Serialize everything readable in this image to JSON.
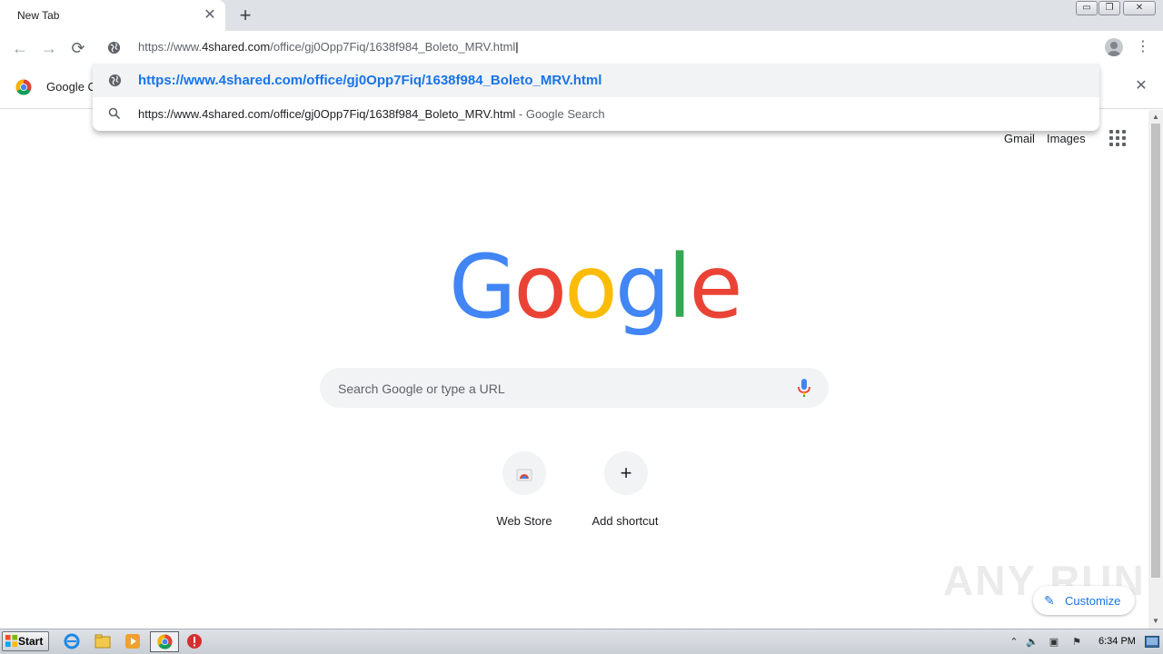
{
  "browser": {
    "tab": {
      "title": "New Tab",
      "close": "✕"
    },
    "new_tab": "+",
    "window_controls": {
      "minimize": "▭",
      "restore": "❐",
      "close": "✕"
    },
    "nav": {
      "back": "←",
      "forward": "→",
      "reload": "⟳"
    },
    "omnibox": {
      "text_prefix": "https://www.",
      "text_domain": "4shared.com",
      "text_path": "/office/gj0Opp7Fiq/1638f984_Boleto_MRV.html"
    },
    "menu": "⋮"
  },
  "infobar": {
    "text": "Google Cl",
    "close": "✕"
  },
  "dropdown": {
    "suggestions": [
      {
        "icon": "globe-icon",
        "text": "https://www.4shared.com/office/gj0Opp7Fiq/1638f984_Boleto_MRV.html"
      },
      {
        "icon": "search-icon",
        "text": "https://www.4shared.com/office/gj0Opp7Fiq/1638f984_Boleto_MRV.html",
        "suffix": " - Google Search"
      }
    ]
  },
  "ntp": {
    "links": {
      "gmail": "Gmail",
      "images": "Images"
    },
    "logo_letters": [
      {
        "char": "G",
        "color": "#4285F4"
      },
      {
        "char": "o",
        "color": "#EA4335"
      },
      {
        "char": "o",
        "color": "#FBBC05"
      },
      {
        "char": "g",
        "color": "#4285F4"
      },
      {
        "char": "l",
        "color": "#34A853"
      },
      {
        "char": "e",
        "color": "#EA4335"
      }
    ],
    "search_placeholder": "Search Google or type a URL",
    "shortcuts": [
      {
        "label": "Web Store",
        "icon": "web-store-icon"
      },
      {
        "label": "Add shortcut",
        "icon": "plus-icon",
        "glyph": "+"
      }
    ],
    "customize": {
      "label": "Customize",
      "icon": "✎"
    }
  },
  "watermark": "ANY RUN",
  "scrollbar": {
    "up": "▲",
    "down": "▼"
  },
  "taskbar": {
    "start": "Start",
    "clock": "6:34 PM",
    "tray": [
      "⌃",
      "🔈",
      "▣",
      "⚑"
    ]
  },
  "colors": {
    "accent_blue": "#1a73e8",
    "tab_strip": "#dee1e6",
    "taskbar": "#d4d8dd"
  }
}
